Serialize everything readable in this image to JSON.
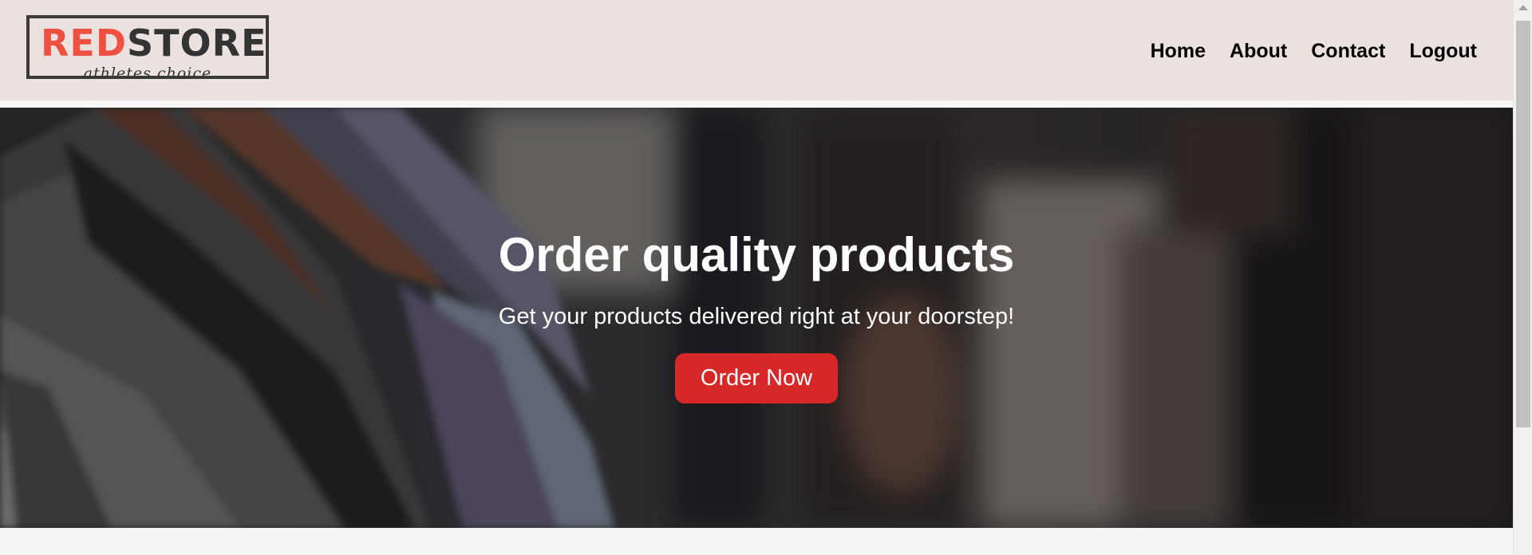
{
  "header": {
    "logo": {
      "red_part": "RED",
      "dark_part": "STORE",
      "tagline": "athletes choice"
    },
    "nav": [
      {
        "label": "Home"
      },
      {
        "label": "About"
      },
      {
        "label": "Contact"
      },
      {
        "label": "Logout"
      }
    ]
  },
  "hero": {
    "title": "Order quality products",
    "subtitle": "Get your products delivered right at your doorstep!",
    "cta_label": "Order Now",
    "background_image": "clothes-on-rack-photo"
  },
  "colors": {
    "header_bg": "#ebe2e0",
    "brand_red": "#f0503f",
    "button_red": "#d62828",
    "page_bg": "#f4f4f4"
  },
  "icons": {
    "scroll_up": "scroll-up-arrow-icon"
  }
}
